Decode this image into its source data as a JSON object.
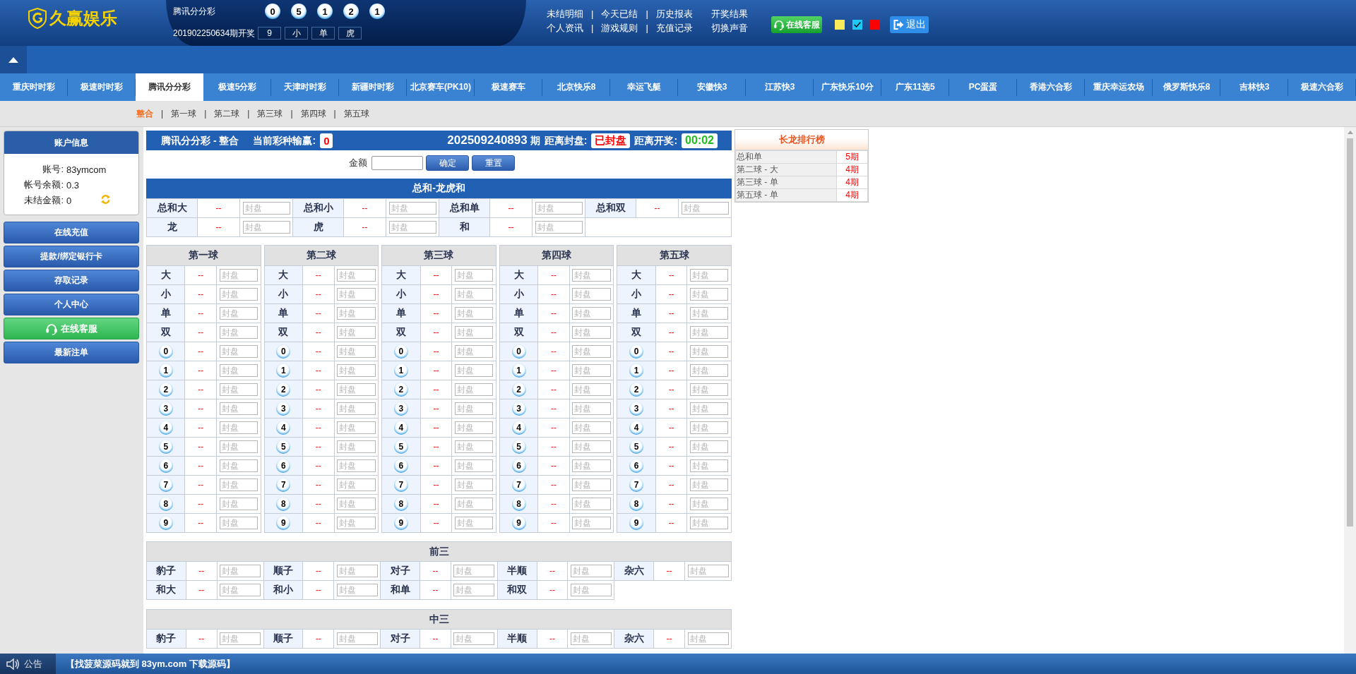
{
  "header": {
    "logo": "久赢娱乐",
    "lottery": "腾讯分分彩",
    "balls": [
      "0",
      "5",
      "1",
      "2",
      "1"
    ],
    "draw_label": "201902250634期开奖",
    "draw_results": [
      "9",
      "小",
      "单",
      "虎"
    ],
    "links": [
      [
        {
          "label": "未结明细"
        },
        {
          "label": "今天已结",
          "separator": "|"
        },
        {
          "label": "历史报表",
          "separator": "|"
        },
        {
          "label": "开奖结果"
        }
      ],
      [
        {
          "label": "个人资讯"
        },
        {
          "label": "游戏规则",
          "separator": "|"
        },
        {
          "label": "充值记录",
          "separator": "|"
        },
        {
          "label": "切换声音"
        }
      ]
    ],
    "service_button": "在线客服",
    "themes": [
      {
        "color": "#fbe95c",
        "selected": false
      },
      {
        "color": "#1ec8f5",
        "selected": true
      },
      {
        "color": "#ff0000",
        "selected": false
      }
    ],
    "logout": "退出"
  },
  "tabs": [
    {
      "label": "重庆时时彩",
      "selected": false
    },
    {
      "label": "极速时时彩",
      "selected": false
    },
    {
      "label": "腾讯分分彩",
      "selected": true
    },
    {
      "label": "极速5分彩",
      "selected": false
    },
    {
      "label": "天津时时彩",
      "selected": false
    },
    {
      "label": "新疆时时彩",
      "selected": false
    },
    {
      "label": "北京赛车(PK10)",
      "selected": false
    },
    {
      "label": "极速赛车",
      "selected": false
    },
    {
      "label": "北京快乐8",
      "selected": false
    },
    {
      "label": "幸运飞艇",
      "selected": false
    },
    {
      "label": "安徽快3",
      "selected": false
    },
    {
      "label": "江苏快3",
      "selected": false
    },
    {
      "label": "广东快乐10分",
      "selected": false
    },
    {
      "label": "广东11选5",
      "selected": false
    },
    {
      "label": "PC蛋蛋",
      "selected": false
    },
    {
      "label": "香港六合彩",
      "selected": false
    },
    {
      "label": "重庆幸运农场",
      "selected": false
    },
    {
      "label": "俄罗斯快乐8",
      "selected": false
    },
    {
      "label": "吉林快3",
      "selected": false
    },
    {
      "label": "极速六合彩",
      "selected": false
    }
  ],
  "subnav": [
    {
      "label": "整合",
      "selected": true
    },
    {
      "label": "第一球",
      "separator": "|",
      "selected": false
    },
    {
      "label": "第二球",
      "separator": "|",
      "selected": false
    },
    {
      "label": "第三球",
      "separator": "|",
      "selected": false
    },
    {
      "label": "第四球",
      "separator": "|",
      "selected": false
    },
    {
      "label": "第五球",
      "separator": "|",
      "selected": false
    }
  ],
  "sidebar": {
    "account": {
      "title": "账户信息",
      "rows": [
        {
          "kind": "plain",
          "label": "账号:",
          "value": "83ymcom"
        },
        {
          "kind": "plain",
          "label": "帐号余额:",
          "value": "0.3"
        },
        {
          "kind": "refresh",
          "label": "未结金额:",
          "value": "0"
        }
      ]
    },
    "buttons": [
      {
        "kind": "plain",
        "label": "在线充值"
      },
      {
        "kind": "plain",
        "label": "提款/绑定银行卡"
      },
      {
        "kind": "plain",
        "label": "存取记录"
      },
      {
        "kind": "plain",
        "label": "个人中心"
      },
      {
        "kind": "service",
        "label": "在线客服"
      },
      {
        "kind": "plain",
        "label": "最新注单"
      }
    ]
  },
  "info_bar": {
    "title": "腾讯分分彩 - 整合",
    "winloss_label": "当前彩种输赢:",
    "winloss": "0",
    "period": "202509240893",
    "period_suffix": "期",
    "close_label": "距离封盘:",
    "close_status": "已封盘",
    "open_label": "距离开奖:",
    "countdown": "00:02"
  },
  "amount": {
    "label": "金额",
    "confirm": "确定",
    "reset": "重置"
  },
  "sum_section": {
    "title": "总和-龙虎和",
    "rows": [
      [
        {
          "label": "总和大",
          "odds": "--",
          "placeholder": "封盘"
        },
        {
          "label": "总和小",
          "odds": "--",
          "placeholder": "封盘"
        },
        {
          "label": "总和单",
          "odds": "--",
          "placeholder": "封盘"
        },
        {
          "label": "总和双",
          "odds": "--",
          "placeholder": "封盘"
        }
      ],
      [
        {
          "label": "龙",
          "odds": "--",
          "placeholder": "封盘"
        },
        {
          "label": "虎",
          "odds": "--",
          "placeholder": "封盘"
        },
        {
          "label": "和",
          "odds": "--",
          "placeholder": "封盘"
        }
      ]
    ]
  },
  "ball_tables": [
    {
      "title": "第一球",
      "rows": [
        {
          "kind": "text",
          "label": "大",
          "odds": "--",
          "placeholder": "封盘"
        },
        {
          "kind": "text",
          "label": "小",
          "odds": "--",
          "placeholder": "封盘"
        },
        {
          "kind": "text",
          "label": "单",
          "odds": "--",
          "placeholder": "封盘"
        },
        {
          "kind": "text",
          "label": "双",
          "odds": "--",
          "placeholder": "封盘"
        },
        {
          "kind": "ball",
          "label": "0",
          "odds": "--",
          "placeholder": "封盘"
        },
        {
          "kind": "ball",
          "label": "1",
          "odds": "--",
          "placeholder": "封盘"
        },
        {
          "kind": "ball",
          "label": "2",
          "odds": "--",
          "placeholder": "封盘"
        },
        {
          "kind": "ball",
          "label": "3",
          "odds": "--",
          "placeholder": "封盘"
        },
        {
          "kind": "ball",
          "label": "4",
          "odds": "--",
          "placeholder": "封盘"
        },
        {
          "kind": "ball",
          "label": "5",
          "odds": "--",
          "placeholder": "封盘"
        },
        {
          "kind": "ball",
          "label": "6",
          "odds": "--",
          "placeholder": "封盘"
        },
        {
          "kind": "ball",
          "label": "7",
          "odds": "--",
          "placeholder": "封盘"
        },
        {
          "kind": "ball",
          "label": "8",
          "odds": "--",
          "placeholder": "封盘"
        },
        {
          "kind": "ball",
          "label": "9",
          "odds": "--",
          "placeholder": "封盘"
        }
      ]
    },
    {
      "title": "第二球",
      "rows": [
        {
          "kind": "text",
          "label": "大",
          "odds": "--",
          "placeholder": "封盘"
        },
        {
          "kind": "text",
          "label": "小",
          "odds": "--",
          "placeholder": "封盘"
        },
        {
          "kind": "text",
          "label": "单",
          "odds": "--",
          "placeholder": "封盘"
        },
        {
          "kind": "text",
          "label": "双",
          "odds": "--",
          "placeholder": "封盘"
        },
        {
          "kind": "ball",
          "label": "0",
          "odds": "--",
          "placeholder": "封盘"
        },
        {
          "kind": "ball",
          "label": "1",
          "odds": "--",
          "placeholder": "封盘"
        },
        {
          "kind": "ball",
          "label": "2",
          "odds": "--",
          "placeholder": "封盘"
        },
        {
          "kind": "ball",
          "label": "3",
          "odds": "--",
          "placeholder": "封盘"
        },
        {
          "kind": "ball",
          "label": "4",
          "odds": "--",
          "placeholder": "封盘"
        },
        {
          "kind": "ball",
          "label": "5",
          "odds": "--",
          "placeholder": "封盘"
        },
        {
          "kind": "ball",
          "label": "6",
          "odds": "--",
          "placeholder": "封盘"
        },
        {
          "kind": "ball",
          "label": "7",
          "odds": "--",
          "placeholder": "封盘"
        },
        {
          "kind": "ball",
          "label": "8",
          "odds": "--",
          "placeholder": "封盘"
        },
        {
          "kind": "ball",
          "label": "9",
          "odds": "--",
          "placeholder": "封盘"
        }
      ]
    },
    {
      "title": "第三球",
      "rows": [
        {
          "kind": "text",
          "label": "大",
          "odds": "--",
          "placeholder": "封盘"
        },
        {
          "kind": "text",
          "label": "小",
          "odds": "--",
          "placeholder": "封盘"
        },
        {
          "kind": "text",
          "label": "单",
          "odds": "--",
          "placeholder": "封盘"
        },
        {
          "kind": "text",
          "label": "双",
          "odds": "--",
          "placeholder": "封盘"
        },
        {
          "kind": "ball",
          "label": "0",
          "odds": "--",
          "placeholder": "封盘"
        },
        {
          "kind": "ball",
          "label": "1",
          "odds": "--",
          "placeholder": "封盘"
        },
        {
          "kind": "ball",
          "label": "2",
          "odds": "--",
          "placeholder": "封盘"
        },
        {
          "kind": "ball",
          "label": "3",
          "odds": "--",
          "placeholder": "封盘"
        },
        {
          "kind": "ball",
          "label": "4",
          "odds": "--",
          "placeholder": "封盘"
        },
        {
          "kind": "ball",
          "label": "5",
          "odds": "--",
          "placeholder": "封盘"
        },
        {
          "kind": "ball",
          "label": "6",
          "odds": "--",
          "placeholder": "封盘"
        },
        {
          "kind": "ball",
          "label": "7",
          "odds": "--",
          "placeholder": "封盘"
        },
        {
          "kind": "ball",
          "label": "8",
          "odds": "--",
          "placeholder": "封盘"
        },
        {
          "kind": "ball",
          "label": "9",
          "odds": "--",
          "placeholder": "封盘"
        }
      ]
    },
    {
      "title": "第四球",
      "rows": [
        {
          "kind": "text",
          "label": "大",
          "odds": "--",
          "placeholder": "封盘"
        },
        {
          "kind": "text",
          "label": "小",
          "odds": "--",
          "placeholder": "封盘"
        },
        {
          "kind": "text",
          "label": "单",
          "odds": "--",
          "placeholder": "封盘"
        },
        {
          "kind": "text",
          "label": "双",
          "odds": "--",
          "placeholder": "封盘"
        },
        {
          "kind": "ball",
          "label": "0",
          "odds": "--",
          "placeholder": "封盘"
        },
        {
          "kind": "ball",
          "label": "1",
          "odds": "--",
          "placeholder": "封盘"
        },
        {
          "kind": "ball",
          "label": "2",
          "odds": "--",
          "placeholder": "封盘"
        },
        {
          "kind": "ball",
          "label": "3",
          "odds": "--",
          "placeholder": "封盘"
        },
        {
          "kind": "ball",
          "label": "4",
          "odds": "--",
          "placeholder": "封盘"
        },
        {
          "kind": "ball",
          "label": "5",
          "odds": "--",
          "placeholder": "封盘"
        },
        {
          "kind": "ball",
          "label": "6",
          "odds": "--",
          "placeholder": "封盘"
        },
        {
          "kind": "ball",
          "label": "7",
          "odds": "--",
          "placeholder": "封盘"
        },
        {
          "kind": "ball",
          "label": "8",
          "odds": "--",
          "placeholder": "封盘"
        },
        {
          "kind": "ball",
          "label": "9",
          "odds": "--",
          "placeholder": "封盘"
        }
      ]
    },
    {
      "title": "第五球",
      "rows": [
        {
          "kind": "text",
          "label": "大",
          "odds": "--",
          "placeholder": "封盘"
        },
        {
          "kind": "text",
          "label": "小",
          "odds": "--",
          "placeholder": "封盘"
        },
        {
          "kind": "text",
          "label": "单",
          "odds": "--",
          "placeholder": "封盘"
        },
        {
          "kind": "text",
          "label": "双",
          "odds": "--",
          "placeholder": "封盘"
        },
        {
          "kind": "ball",
          "label": "0",
          "odds": "--",
          "placeholder": "封盘"
        },
        {
          "kind": "ball",
          "label": "1",
          "odds": "--",
          "placeholder": "封盘"
        },
        {
          "kind": "ball",
          "label": "2",
          "odds": "--",
          "placeholder": "封盘"
        },
        {
          "kind": "ball",
          "label": "3",
          "odds": "--",
          "placeholder": "封盘"
        },
        {
          "kind": "ball",
          "label": "4",
          "odds": "--",
          "placeholder": "封盘"
        },
        {
          "kind": "ball",
          "label": "5",
          "odds": "--",
          "placeholder": "封盘"
        },
        {
          "kind": "ball",
          "label": "6",
          "odds": "--",
          "placeholder": "封盘"
        },
        {
          "kind": "ball",
          "label": "7",
          "odds": "--",
          "placeholder": "封盘"
        },
        {
          "kind": "ball",
          "label": "8",
          "odds": "--",
          "placeholder": "封盘"
        },
        {
          "kind": "ball",
          "label": "9",
          "odds": "--",
          "placeholder": "封盘"
        }
      ]
    }
  ],
  "combo_sections": [
    {
      "title": "前三",
      "rows": [
        [
          {
            "label": "豹子",
            "odds": "--",
            "placeholder": "封盘"
          },
          {
            "label": "顺子",
            "odds": "--",
            "placeholder": "封盘"
          },
          {
            "label": "对子",
            "odds": "--",
            "placeholder": "封盘"
          },
          {
            "label": "半顺",
            "odds": "--",
            "placeholder": "封盘"
          },
          {
            "label": "杂六",
            "odds": "--",
            "placeholder": "封盘"
          }
        ],
        [
          {
            "label": "和大",
            "odds": "--",
            "placeholder": "封盘"
          },
          {
            "label": "和小",
            "odds": "--",
            "placeholder": "封盘"
          },
          {
            "label": "和单",
            "odds": "--",
            "placeholder": "封盘"
          },
          {
            "label": "和双",
            "odds": "--",
            "placeholder": "封盘"
          }
        ]
      ]
    },
    {
      "title": "中三",
      "rows": [
        [
          {
            "label": "豹子",
            "odds": "--",
            "placeholder": "封盘"
          },
          {
            "label": "顺子",
            "odds": "--",
            "placeholder": "封盘"
          },
          {
            "label": "对子",
            "odds": "--",
            "placeholder": "封盘"
          },
          {
            "label": "半顺",
            "odds": "--",
            "placeholder": "封盘"
          },
          {
            "label": "杂六",
            "odds": "--",
            "placeholder": "封盘"
          }
        ]
      ]
    }
  ],
  "rank": {
    "title": "长龙排行榜",
    "rows": [
      {
        "label": "总和单",
        "count": "5期"
      },
      {
        "label": "第二球 - 大",
        "count": "4期"
      },
      {
        "label": "第三球 - 单",
        "count": "4期"
      },
      {
        "label": "第五球 - 单",
        "count": "4期"
      }
    ]
  },
  "notice": {
    "label": "公告",
    "text": "【找菠菜源码就到 83ym.com 下载源码】"
  }
}
